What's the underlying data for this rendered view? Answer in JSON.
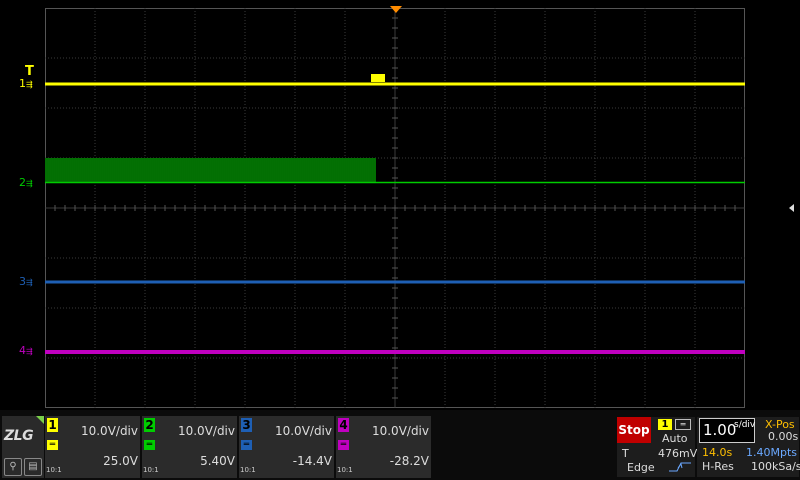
{
  "colors": {
    "ch1": "#ffff00",
    "ch2": "#00cc00",
    "ch2_fill": "#006400",
    "ch3": "#1e5fb4",
    "ch4": "#c000c0",
    "trigger_marker": "#ff8c00",
    "stop": "#c00000"
  },
  "screen": {
    "trigger_label": "T",
    "channel_markers": [
      {
        "label": "1",
        "color": "#ffff00"
      },
      {
        "label": "2",
        "color": "#00cc00"
      },
      {
        "label": "3",
        "color": "#1e5fb4"
      },
      {
        "label": "4",
        "color": "#c000c0"
      }
    ]
  },
  "logo": {
    "text": "ZLG"
  },
  "tools": [
    {
      "icon": "zoom-icon"
    },
    {
      "icon": "measure-icon"
    }
  ],
  "channels": [
    {
      "num": "1",
      "color": "#ffff00",
      "scale": "10.0V/div",
      "offset": "25.0V",
      "probe": "10:1"
    },
    {
      "num": "2",
      "color": "#00cc00",
      "scale": "10.0V/div",
      "offset": "5.40V",
      "probe": "10:1"
    },
    {
      "num": "3",
      "color": "#1e5fb4",
      "scale": "10.0V/div",
      "offset": "-14.4V",
      "probe": "10:1"
    },
    {
      "num": "4",
      "color": "#c000c0",
      "scale": "10.0V/div",
      "offset": "-28.2V",
      "probe": "10:1"
    }
  ],
  "trigger": {
    "status": "Stop",
    "source": "1",
    "mode": "Auto",
    "label": "T",
    "level": "476mV",
    "type": "Edge"
  },
  "timebase": {
    "value": "1.00",
    "unit": "s/div",
    "xpos_label": "X-Pos",
    "xpos_value": "0.00s",
    "total_time": "14.0s",
    "memory_depth": "1.40Mpts",
    "acq_mode": "H-Res",
    "sample_rate": "100kSa/s"
  }
}
